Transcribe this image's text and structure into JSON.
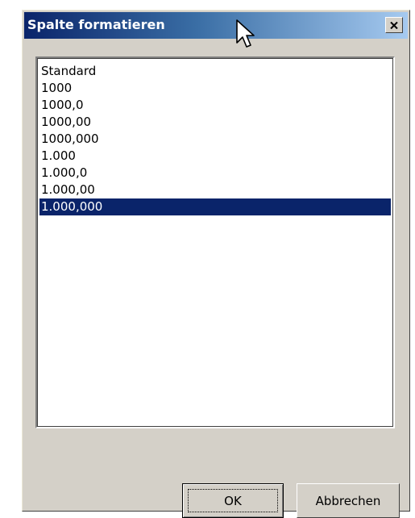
{
  "dialog": {
    "title": "Spalte formatieren",
    "close_icon": "close-x-icon"
  },
  "format_list": {
    "items": [
      "Standard",
      "1000",
      "1000,0",
      "1000,00",
      "1000,000",
      "1.000",
      "1.000,0",
      "1.000,00",
      "1.000,000"
    ],
    "selected": "1.000,000"
  },
  "buttons": {
    "ok_label": "OK",
    "cancel_label": "Abbrechen"
  },
  "colors": {
    "titlebar_start": "#0a246a",
    "titlebar_end": "#a6caf0",
    "selection": "#0a246a",
    "dialog_face": "#d4d0c8"
  }
}
